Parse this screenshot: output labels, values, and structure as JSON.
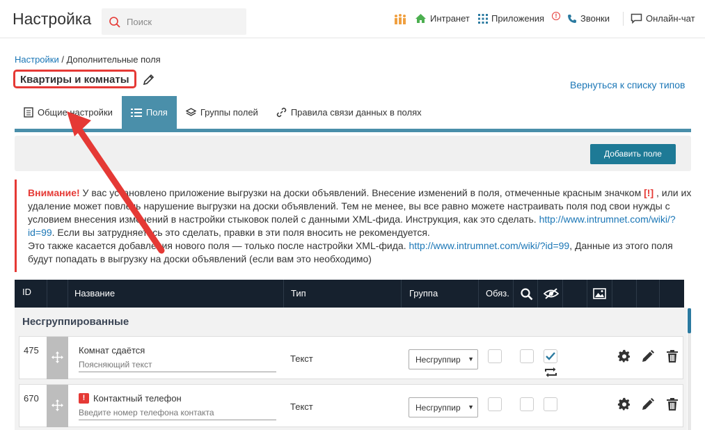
{
  "header": {
    "title": "Настройка",
    "search_placeholder": "Поиск",
    "nav": [
      {
        "label": "Интранет",
        "icon": "home-icon"
      },
      {
        "label": "Приложения",
        "icon": "apps-grid-icon"
      },
      {
        "label": "Звонки",
        "icon": "phone-icon"
      },
      {
        "label": "Онлайн-чат",
        "icon": "chat-icon"
      }
    ],
    "apps_alert": "!"
  },
  "breadcrumb": {
    "root": "Настройки",
    "separator": " / ",
    "current": "Дополнительные поля"
  },
  "entity_title": "Квартиры и комнаты",
  "back_link": "Вернуться к списку типов",
  "tabs": [
    {
      "label": "Общие настройки",
      "active": false
    },
    {
      "label": "Поля",
      "active": true
    },
    {
      "label": "Группы полей",
      "active": false
    },
    {
      "label": "Правила связи данных в полях",
      "active": false
    }
  ],
  "add_button": "Добавить поле",
  "warning": {
    "strong": "Внимание!",
    "t1": " У вас установлено приложение выгрузки на доски объявлений. Внесение изменений в поля, отмеченные красным значком ",
    "mark": "[!]",
    "t2": " , или их удаление может повлечь нарушение выгрузки на доски объявлений. Тем не менее, вы все равно можете настраивать поля под свои нужды с условием внесения изменений в настройки стыковок полей с данными XML-фида. Инструкция, как это сделать. ",
    "url1": "http://www.intrumnet.com/wiki/?id=99",
    "t3": ". Если вы затрудняетесь это сделать, правки в эти поля вносить не рекомендуется.",
    "t4": "Это также касается добавления нового поля — только после настройки XML-фида. ",
    "url2": "http://www.intrumnet.com/wiki/?id=99",
    "t5": ", Данные из этого поля будут попадать в выгрузку на доски объявлений (если вам это необходимо)"
  },
  "table": {
    "columns": {
      "id": "ID",
      "name": "Название",
      "type": "Тип",
      "group": "Группа",
      "required": "Обяз."
    },
    "group_title": "Несгруппированные",
    "rows": [
      {
        "id": "475",
        "name": "Комнат сдаётся",
        "hint": "Поясняющий текст",
        "type": "Текст",
        "group": "Несгруппир",
        "required": false,
        "searchable": false,
        "hidden": true,
        "xml_flag": false
      },
      {
        "id": "670",
        "name": "Контактный телефон",
        "hint": "Введите номер телефона контакта",
        "type": "Текст",
        "group": "Несгруппир",
        "required": false,
        "searchable": false,
        "hidden": false,
        "xml_flag": true,
        "xml_flag_mark": "!"
      }
    ]
  },
  "colors": {
    "accent": "#4a8faa",
    "button": "#1e7a96",
    "link": "#1a76b6",
    "alert": "#e53935",
    "table_header": "#16212e"
  }
}
